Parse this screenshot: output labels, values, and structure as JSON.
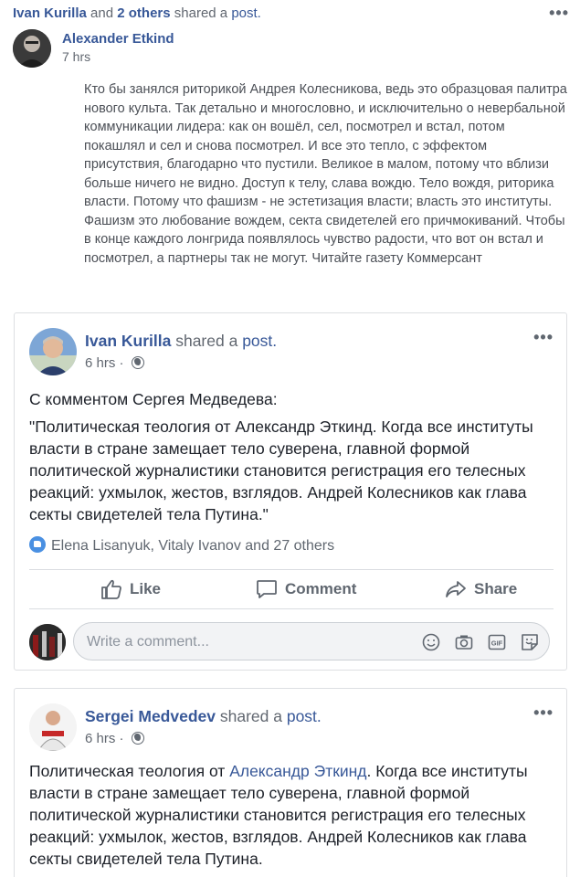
{
  "top_bar": {
    "actor": "Ivan Kurilla",
    "connector": "and",
    "others": "2 others",
    "verb": "shared a",
    "object": "post."
  },
  "outer_post": {
    "author": "Alexander Etkind",
    "time": "7 hrs",
    "text": "Кто бы занялся риторикой Андрея Колесникова, ведь это образцовая палитра нового культа. Так детально и многословно, и исключительно о невербальной коммуникации лидера: как он вошёл, сел, посмотрел и встал, потом покашлял и сел и снова посмотрел. И все это тепло, с эффектом присутствия, благодарно что пустили. Великое в малом, потому что вблизи больше ничего не видно. Доступ к телу, слава вождю. Тело вождя, риторика власти. Потому что фашизм - не эстетизация власти; власть это институты. Фашизм это любование вождем, секта свидетелей его причмокиваний. Чтобы в конце каждого лонгрида появлялось чувство радости, что вот он встал и посмотрел, а партнеры так не могут. Читайте газету Коммерсант"
  },
  "share_card_1": {
    "author": "Ivan Kurilla",
    "verb": "shared a",
    "object": "post.",
    "time": "6 hrs",
    "intro": "С комментом Сергея Медведева:",
    "quote": "\"Политическая теология от Александр Эткинд. Когда все институты власти в стране замещает тело суверена, главной формой политической журналистики становится регистрация его телесных реакций: ухмылок, жестов, взглядов. Андрей Колесников как глава секты свидетелей тела Путина.\"",
    "reactions": "Elena Lisanyuk, Vitaly Ivanov and 27 others",
    "actions": {
      "like": "Like",
      "comment": "Comment",
      "share": "Share"
    },
    "comment_placeholder": "Write a comment..."
  },
  "share_card_2": {
    "author": "Sergei Medvedev",
    "verb": "shared a",
    "object": "post.",
    "time": "6 hrs",
    "text_before": "Политическая теология от ",
    "mention": "Александр Эткинд",
    "text_after": ". Когда все институты власти в стране замещает тело суверена, главной формой политической журналистики становится регистрация его телесных реакций: ухмылок, жестов, взглядов. Андрей Колесников как глава секты свидетелей тела Путина."
  },
  "icons": [
    "more-options-icon",
    "globe-icon",
    "like-thumb-icon",
    "comment-bubble-icon",
    "share-arrow-icon",
    "emoji-icon",
    "camera-icon",
    "gif-icon",
    "sticker-icon",
    "like-reaction-icon"
  ],
  "colors": {
    "link": "#385898",
    "meta": "#616770",
    "reaction_blue": "#4a90e2"
  }
}
